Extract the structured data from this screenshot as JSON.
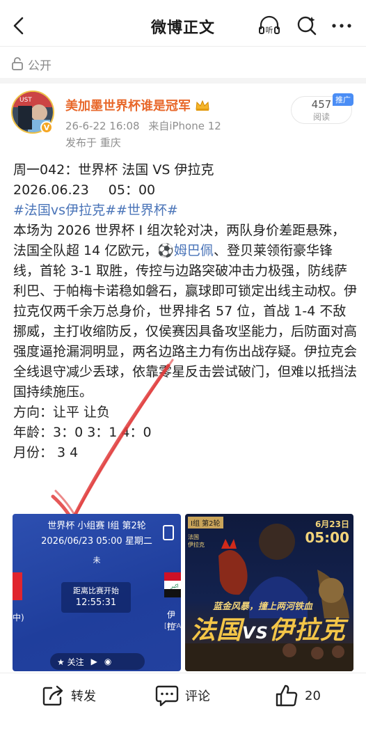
{
  "header": {
    "title": "微博正文"
  },
  "visibility": {
    "label": "公开"
  },
  "post": {
    "author": "美加墨世界杯谁是冠军",
    "timestamp": "26-6-22 16:08",
    "source": "来自iPhone 12",
    "location": "发布于 重庆",
    "read_count": "457",
    "read_label": "阅读",
    "promo_tag": "推广",
    "line1": "周一042：世界杯   法国 VS 伊拉克",
    "line2_date": "2026.06.23",
    "line2_time": "05：00",
    "hashtags": "#法国vs伊拉克##世界杯#",
    "body_before_mention": "本场为 2026 世界杯 I 组次轮对决，两队身价差距悬殊，法国全队超 14 亿欧元，",
    "mention": "⚽姆巴佩",
    "body_after_mention": "、登贝莱领衔豪华锋线，首轮 3-1 取胜，传控与边路突破冲击力极强，防线萨利巴、于帕梅卡诺稳如磐石，赢球即可锁定出线主动权。伊拉克仅两千余万总身价，世界排名 57 位，首战 1-4 不敌挪威，主打收缩防反，仅侯赛因具备攻坚能力，后防面对高强度逼抢漏洞明显，两名边路主力有伤出战存疑。伊拉克会全线退守减少丢球，依靠零星反击尝试破门，但难以抵挡法国持续施压。",
    "direction": "方向：让平   让负",
    "age": "年龄：3：0   3：1   4：0",
    "month": "月份：  3   4"
  },
  "image1": {
    "line1": "世界杯 小组赛 I组 第2轮",
    "line2": "2026/06/23 05:00 星期二",
    "status": "未",
    "countdown_label": "距离比赛开始",
    "countdown": "12:55:31",
    "left_team_partial": "中)",
    "right_team_partial": "伊拉",
    "right_team_sub": "[FIFA",
    "follow_label": "关注"
  },
  "image2": {
    "round_tag": "I组 第2轮",
    "date": "6月23日",
    "time": "05:00",
    "slogan": "蓝金风暴，撞上两河铁血",
    "team_left": "法国",
    "vs": "VS",
    "team_right": "伊拉克",
    "list": "法国\n伊拉克"
  },
  "actions": {
    "repost": "转发",
    "comment": "评论",
    "like_count": "20"
  },
  "colors": {
    "author": "#e8682b",
    "link": "#4a74b8",
    "tick": "#e03b3b",
    "promo": "#4a8df5"
  }
}
